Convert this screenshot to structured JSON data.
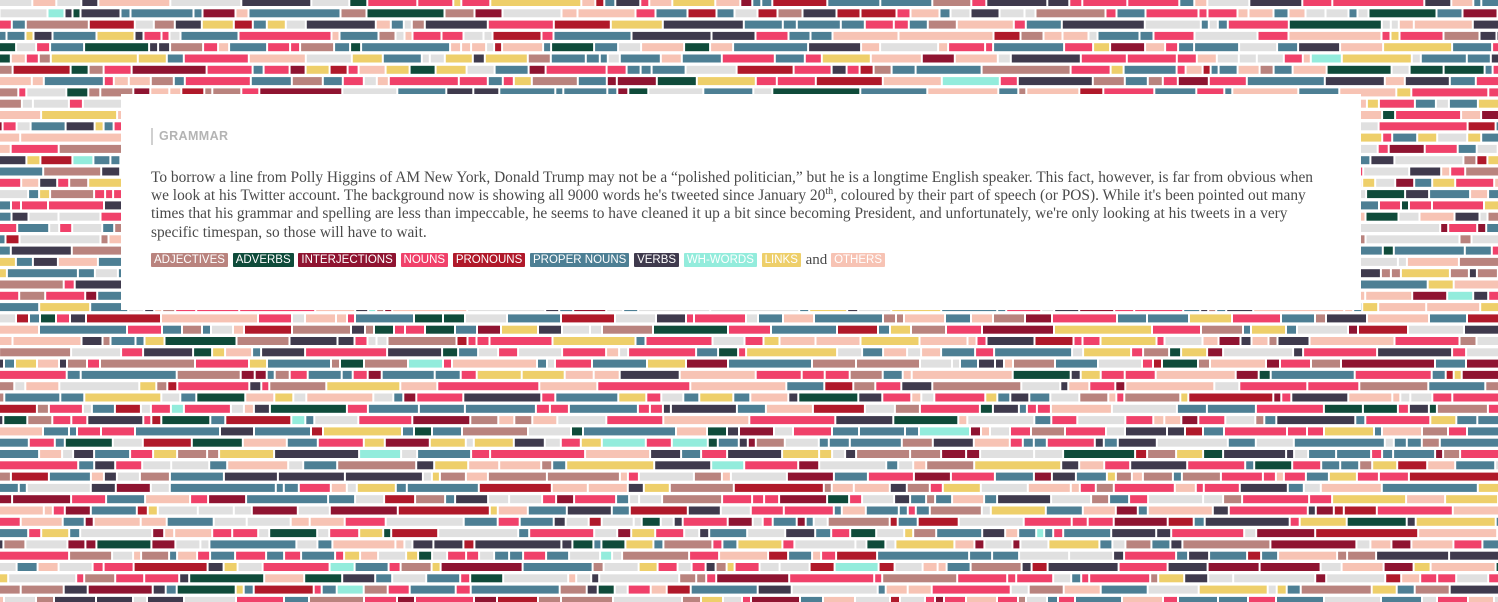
{
  "section": {
    "label": "GRAMMAR"
  },
  "intro": {
    "part1": "To borrow a line from Polly Higgins of AM New York, Donald Trump may not be a “polished politician,” but he is a longtime English speaker. This fact, however, is far from obvious when we look at his Twitter account. The background now is showing all 9000 words he's tweeted since January 20",
    "superscript": "th",
    "part2": ", coloured by their part of speech (or POS). While it's been pointed out many times that his grammar and spelling are less than impeccable, he seems to have cleaned it up a bit since becoming President, and unfortunately, we're only looking at his tweets in a very specific timespan, so those will have to wait."
  },
  "legend": {
    "conjunction": "and",
    "items": [
      {
        "label": "ADJECTIVES",
        "color": "#b9837e"
      },
      {
        "label": "ADVERBS",
        "color": "#0f4b3a"
      },
      {
        "label": "INTERJECTIONS",
        "color": "#8f1431"
      },
      {
        "label": "NOUNS",
        "color": "#f0416a"
      },
      {
        "label": "PRONOUNS",
        "color": "#b0192a"
      },
      {
        "label": "PROPER NOUNS",
        "color": "#4d7f94"
      },
      {
        "label": "VERBS",
        "color": "#3f3a4d"
      },
      {
        "label": "WH-WORDS",
        "color": "#93ecdc"
      },
      {
        "label": "LINKS",
        "color": "#eecf6a"
      },
      {
        "label": "OTHERS",
        "color": "#f7c3b4"
      }
    ]
  },
  "background": {
    "filler_color": "#e0e0e0"
  }
}
